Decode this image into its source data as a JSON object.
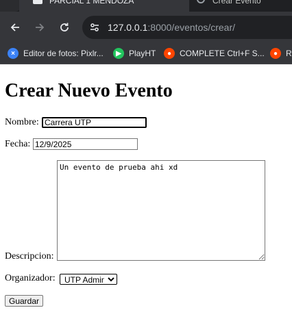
{
  "browser": {
    "tabs": [
      {
        "title": "PARCIAL 1 MENDOZA",
        "active": true
      },
      {
        "title": "Crear Evento",
        "active": false
      }
    ],
    "address_bar": {
      "host": "127.0.0.1",
      "path": ":8000/eventos/crear/"
    },
    "bookmarks": [
      {
        "label": "Editor de fotos: Pixlr...",
        "icon": "pixlr-icon",
        "color": "#3b82f6"
      },
      {
        "label": "PlayHT",
        "icon": "playht-icon",
        "color": "#22c55e"
      },
      {
        "label": "COMPLETE Ctrl+F S...",
        "icon": "reddit-icon",
        "color": "#ff4500"
      },
      {
        "label": "R",
        "icon": "reddit-icon",
        "color": "#ff4500"
      }
    ]
  },
  "page": {
    "title": "Crear Nuevo Evento",
    "form": {
      "nombre_label": "Nombre:",
      "nombre_value": "Carrera UTP",
      "fecha_label": "Fecha:",
      "fecha_value": "12/9/2025",
      "descripcion_label": "Descripcion:",
      "descripcion_value": "Un evento de prueba ahi xd",
      "organizador_label": "Organizador:",
      "organizador_selected": "UTP Admin",
      "submit_label": "Guardar"
    }
  }
}
